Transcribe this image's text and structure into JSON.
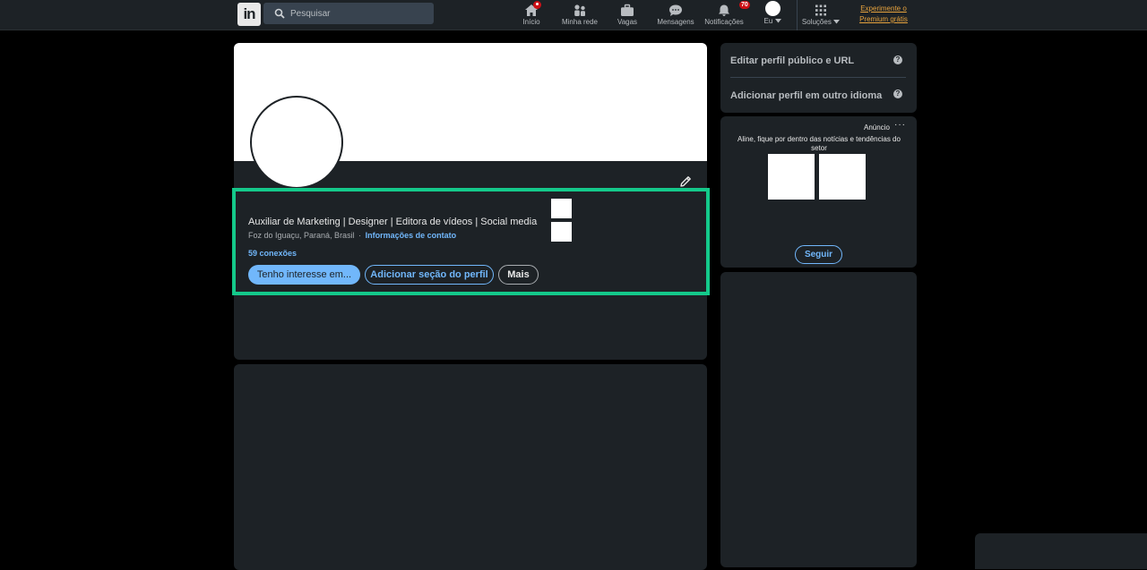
{
  "nav": {
    "search_placeholder": "Pesquisar",
    "items": [
      {
        "label": "Início",
        "icon": "home-icon",
        "badge": ""
      },
      {
        "label": "Minha rede",
        "icon": "network-icon",
        "badge": ""
      },
      {
        "label": "Vagas",
        "icon": "briefcase-icon",
        "badge": ""
      },
      {
        "label": "Mensagens",
        "icon": "message-icon",
        "badge": ""
      },
      {
        "label": "Notificações",
        "icon": "bell-icon",
        "badge": "70"
      },
      {
        "label": "Eu",
        "icon": "avatar",
        "badge": ""
      },
      {
        "label": "Soluções",
        "icon": "grid-icon",
        "badge": ""
      }
    ],
    "premium_line1": "Experimente o",
    "premium_line2": "Premium grátis"
  },
  "profile": {
    "headline": "Auxiliar de Marketing | Designer | Editora de vídeos | Social media",
    "location": "Foz do Iguaçu, Paraná, Brasil",
    "separator": "·",
    "contact_info": "Informações de contato",
    "connections": "59 conexões",
    "buttons": {
      "interest": "Tenho interesse em...",
      "add_section": "Adicionar seção do perfil",
      "more": "Mais"
    }
  },
  "sidebar": {
    "edit_public_profile": "Editar perfil público e URL",
    "add_language_profile": "Adicionar perfil em outro idioma",
    "help_glyph": "?"
  },
  "ad": {
    "label": "Anúncio",
    "dots": "···",
    "text": "Aline, fique por dentro das notícias e tendências do setor",
    "follow": "Seguir"
  },
  "colors": {
    "background": "#000000",
    "card": "#1d2226",
    "accent_blue": "#71b7fb",
    "highlight_green": "#14c98a",
    "premium_gold": "#e7a33e",
    "badge_red": "#cc1016"
  }
}
